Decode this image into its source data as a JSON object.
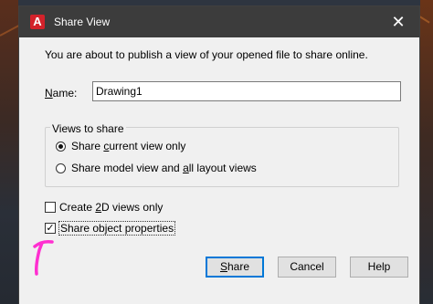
{
  "dialog": {
    "title": "Share View",
    "app_icon": "A",
    "close_glyph": "✕",
    "intro": "You are about to publish a view of your opened file to share online.",
    "name_label": "Name:",
    "name_value": "Drawing1",
    "views_group_label": "Views to share",
    "radios": [
      {
        "label": "Share current view only",
        "checked": true
      },
      {
        "label": "Share model view and all layout views",
        "checked": false
      }
    ],
    "checkboxes": [
      {
        "label": "Create 2D views only",
        "checked": false
      },
      {
        "label": "Share object properties",
        "checked": true
      }
    ],
    "buttons": {
      "share": "Share",
      "cancel": "Cancel",
      "help": "Help"
    }
  },
  "colors": {
    "titlebar": "#3c3c3c",
    "dialog_bg": "#f0f0f0",
    "default_button_border": "#0078d7",
    "annotation": "#ff2fd0",
    "app_icon_red": "#d3222a"
  }
}
